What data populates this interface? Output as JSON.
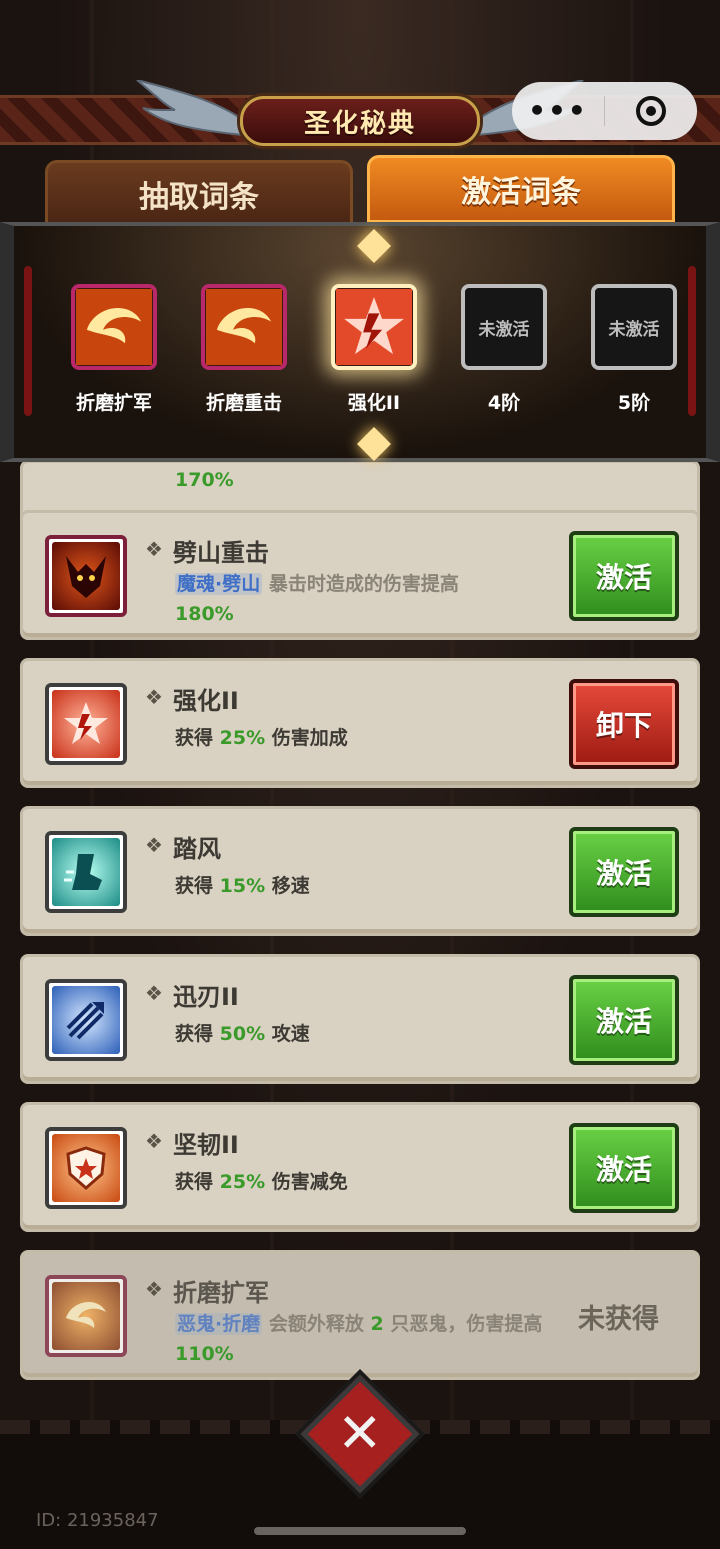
{
  "title": "圣化秘典",
  "capsule": {
    "more": "•••"
  },
  "tabs": {
    "draw": "抽取词条",
    "activate": "激活词条"
  },
  "slots": [
    {
      "name": "折磨扩军",
      "icon": "fire-swirl-icon"
    },
    {
      "name": "折磨重击",
      "icon": "fire-swirl-icon"
    },
    {
      "name": "强化II",
      "icon": "empower-icon",
      "selected": true
    },
    {
      "name": "4阶",
      "empty_label": "未激活"
    },
    {
      "name": "5阶",
      "empty_label": "未激活"
    }
  ],
  "cards": [
    {
      "name": "劈山重击",
      "tag": "魔魂·劈山",
      "desc_grey": "暴击时造成的伤害提高",
      "value": "180%",
      "button": "激活",
      "icon": "demon-icon"
    },
    {
      "name": "强化II",
      "prefix": "获得",
      "value": "25%",
      "suffix": "伤害加成",
      "button": "卸下",
      "icon": "empower-icon"
    },
    {
      "name": "踏风",
      "prefix": "获得",
      "value": "15%",
      "suffix": "移速",
      "button": "激活",
      "icon": "boot-icon"
    },
    {
      "name": "迅刃II",
      "prefix": "获得",
      "value": "50%",
      "suffix": "攻速",
      "button": "激活",
      "icon": "arrows-icon"
    },
    {
      "name": "坚韧II",
      "prefix": "获得",
      "value": "25%",
      "suffix": "伤害减免",
      "button": "激活",
      "icon": "shield-star-icon"
    },
    {
      "name": "折磨扩军",
      "tag": "恶鬼·折磨",
      "desc_grey_1": "会额外释放",
      "count": "2",
      "desc_grey_2": "只恶鬼，伤害提高",
      "value": "110%",
      "status": "未获得",
      "icon": "fire-swirl-icon"
    }
  ],
  "partial_value": "170%",
  "footer": {
    "id": "ID: 21935847"
  },
  "colors": {
    "activate_green": "#3fa82a",
    "unequip_red": "#c0281c",
    "accent_orange": "#f08a22"
  }
}
